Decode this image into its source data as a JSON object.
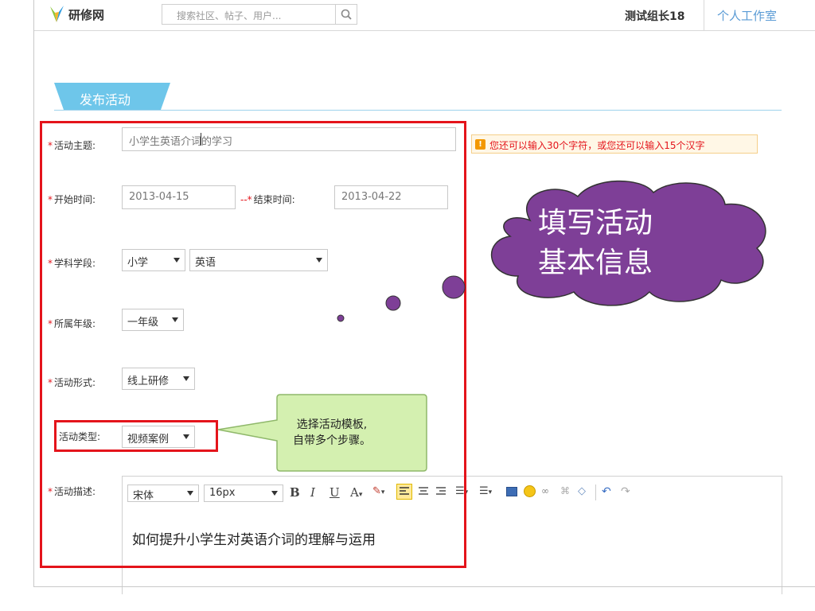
{
  "header": {
    "logo_text": "研修网",
    "search_placeholder": "搜索社区、帖子、用户...",
    "username": "测试组长18",
    "workspace_link": "个人工作室"
  },
  "page": {
    "tab_label": "发布活动"
  },
  "form": {
    "required_mark": "*",
    "topic": {
      "label": "活动主题:",
      "value": "小学生英语介词的学习"
    },
    "topic_hint": "您还可以输入30个字符，或您还可以输入15个汉字",
    "start_time": {
      "label": "开始时间:",
      "value": "2013-04-15"
    },
    "end_time": {
      "label": "结束时间:",
      "value": "2013-04-22",
      "prefix": "--"
    },
    "subject_stage": {
      "label": "学科学段:",
      "stage_value": "小学",
      "subject_value": "英语"
    },
    "grade": {
      "label": "所属年级:",
      "value": "一年级"
    },
    "form_type": {
      "label": "活动形式:",
      "value": "线上研修"
    },
    "activity_type": {
      "label": "活动类型:",
      "value": "视频案例"
    },
    "description": {
      "label": "活动描述:",
      "font_family": "宋体",
      "font_size": "16px",
      "content": "如何提升小学生对英语介词的理解与运用"
    }
  },
  "toolbar": {
    "bold": "B",
    "italic": "I",
    "underline": "U",
    "font_color": "A"
  },
  "annotations": {
    "cloud_line1": "填写活动",
    "cloud_line2": "基本信息",
    "callout_line1": "选择活动模板,",
    "callout_line2": "自带多个步骤。"
  },
  "colors": {
    "accent_blue": "#5a9bd5",
    "tab_blue": "#6ec6ea",
    "highlight_red": "#e4141b",
    "cloud_purple": "#7e3f97",
    "callout_green": "#d4f0b0"
  }
}
